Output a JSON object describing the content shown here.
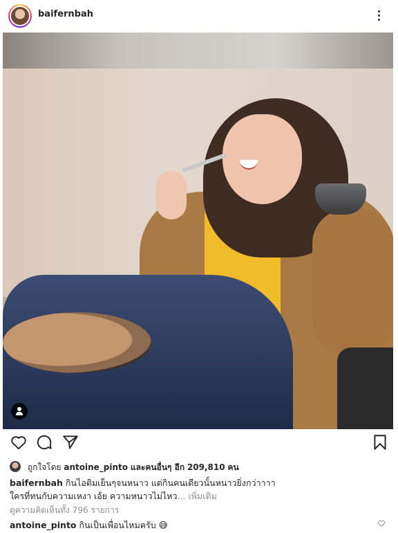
{
  "post": {
    "username": "baifernbah"
  },
  "icons": {
    "more": "more-vertical-icon",
    "like": "heart-outline-icon",
    "comment": "comment-outline-icon",
    "share": "paper-plane-icon",
    "save": "bookmark-outline-icon",
    "tag": "user-tag-icon",
    "comment_like": "small-heart-icon"
  },
  "likes": {
    "prefix": "ถูกใจโดย",
    "user": "antoine_pinto",
    "middle": "และคนอื่นๆ อีก",
    "count": "209,810",
    "suffix": "คน"
  },
  "caption": {
    "username": "baifernbah",
    "line1": "กินไอติมเย็นๆจนหนาว แต่กินคนเดียวนั้นหนาวยิ่งกว่าาาา",
    "line2": "ใครที่ทนกับความเหงา เอ้ย ความหนาวไม่ไหว",
    "more": "... เพิ่มเติม"
  },
  "comments": {
    "view_all": "ดูความคิดเห็นทั้ง 796 รายการ",
    "first_user": "antoine_pinto",
    "first_text": "กินเป็นเพื่อนไหมครับ 😅"
  },
  "colors": {
    "text": "#262626",
    "muted": "#8e8e8e",
    "background": "#ffffff"
  }
}
